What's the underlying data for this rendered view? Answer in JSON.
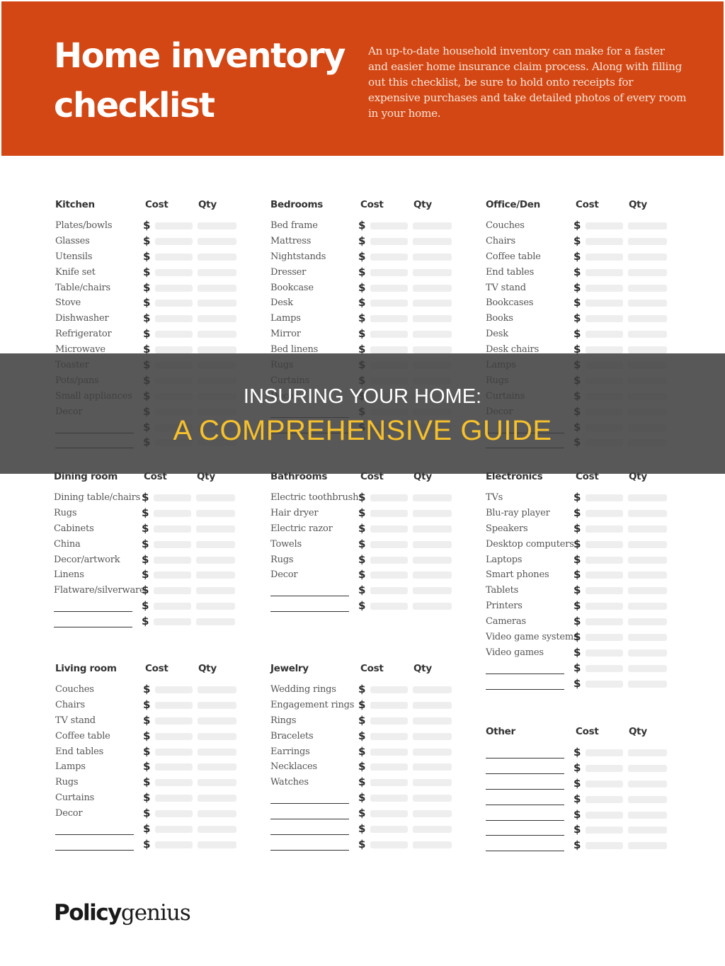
{
  "header": {
    "title_line1": "Home inventory",
    "title_line2": "checklist",
    "intro": "An up-to-date household inventory can make for a faster and easier home insurance claim process. Along with filling out this checklist, be sure to hold onto receipts for expensive purchases and take detailed photos of every room in your home."
  },
  "columns": {
    "cost": "Cost",
    "qty": "Qty",
    "currency_symbol": "$"
  },
  "sections": [
    {
      "name": "Kitchen",
      "items": [
        "Plates/bowls",
        "Glasses",
        "Utensils",
        "Knife set",
        "Table/chairs",
        "Stove",
        "Dishwasher",
        "Refrigerator",
        "Microwave",
        "Toaster",
        "Pots/pans",
        "Small appliances",
        "Decor",
        "",
        ""
      ]
    },
    {
      "name": "Bedrooms",
      "items": [
        "Bed frame",
        "Mattress",
        "Nightstands",
        "Dresser",
        "Bookcase",
        "Desk",
        "Lamps",
        "Mirror",
        "Bed linens",
        "Rugs",
        "Curtains",
        "Decor",
        "",
        ""
      ]
    },
    {
      "name": "Office/Den",
      "items": [
        "Couches",
        "Chairs",
        "Coffee table",
        "End tables",
        "TV stand",
        "Bookcases",
        "Books",
        "Desk",
        "Desk chairs",
        "Lamps",
        "Rugs",
        "Curtains",
        "Decor",
        "",
        ""
      ]
    },
    {
      "name": "Dining room",
      "items": [
        "Dining table/chairs",
        "Rugs",
        "Cabinets",
        "China",
        "Decor/artwork",
        "Linens",
        "Flatware/silverware",
        "",
        ""
      ]
    },
    {
      "name": "Bathrooms",
      "items": [
        "Electric toothbrush",
        "Hair dryer",
        "Electric razor",
        "Towels",
        "Rugs",
        "Decor",
        "",
        ""
      ]
    },
    {
      "name": "Electronics",
      "items": [
        "TVs",
        "Blu-ray player",
        "Speakers",
        "Desktop computers",
        "Laptops",
        "Smart phones",
        "Tablets",
        "Printers",
        "Cameras",
        "Video game systems",
        "Video games",
        "",
        ""
      ]
    },
    {
      "name": "Living room",
      "items": [
        "Couches",
        "Chairs",
        "TV stand",
        "Coffee table",
        "End tables",
        "Lamps",
        "Rugs",
        "Curtains",
        "Decor",
        "",
        ""
      ]
    },
    {
      "name": "Jewelry",
      "items": [
        "Wedding rings",
        "Engagement rings",
        "Rings",
        "Bracelets",
        "Earrings",
        "Necklaces",
        "Watches",
        "",
        "",
        "",
        ""
      ]
    },
    {
      "name": "Other",
      "items": [
        "",
        "",
        "",
        "",
        "",
        "",
        ""
      ]
    }
  ],
  "logo": {
    "bold": "Policy",
    "regular": "genius"
  },
  "overlay": {
    "line1": "INSURING YOUR HOME:",
    "line2": "A COMPREHENSIVE GUIDE"
  },
  "colors": {
    "brand_orange": "#d24714",
    "overlay_accent": "#f7c12b"
  }
}
